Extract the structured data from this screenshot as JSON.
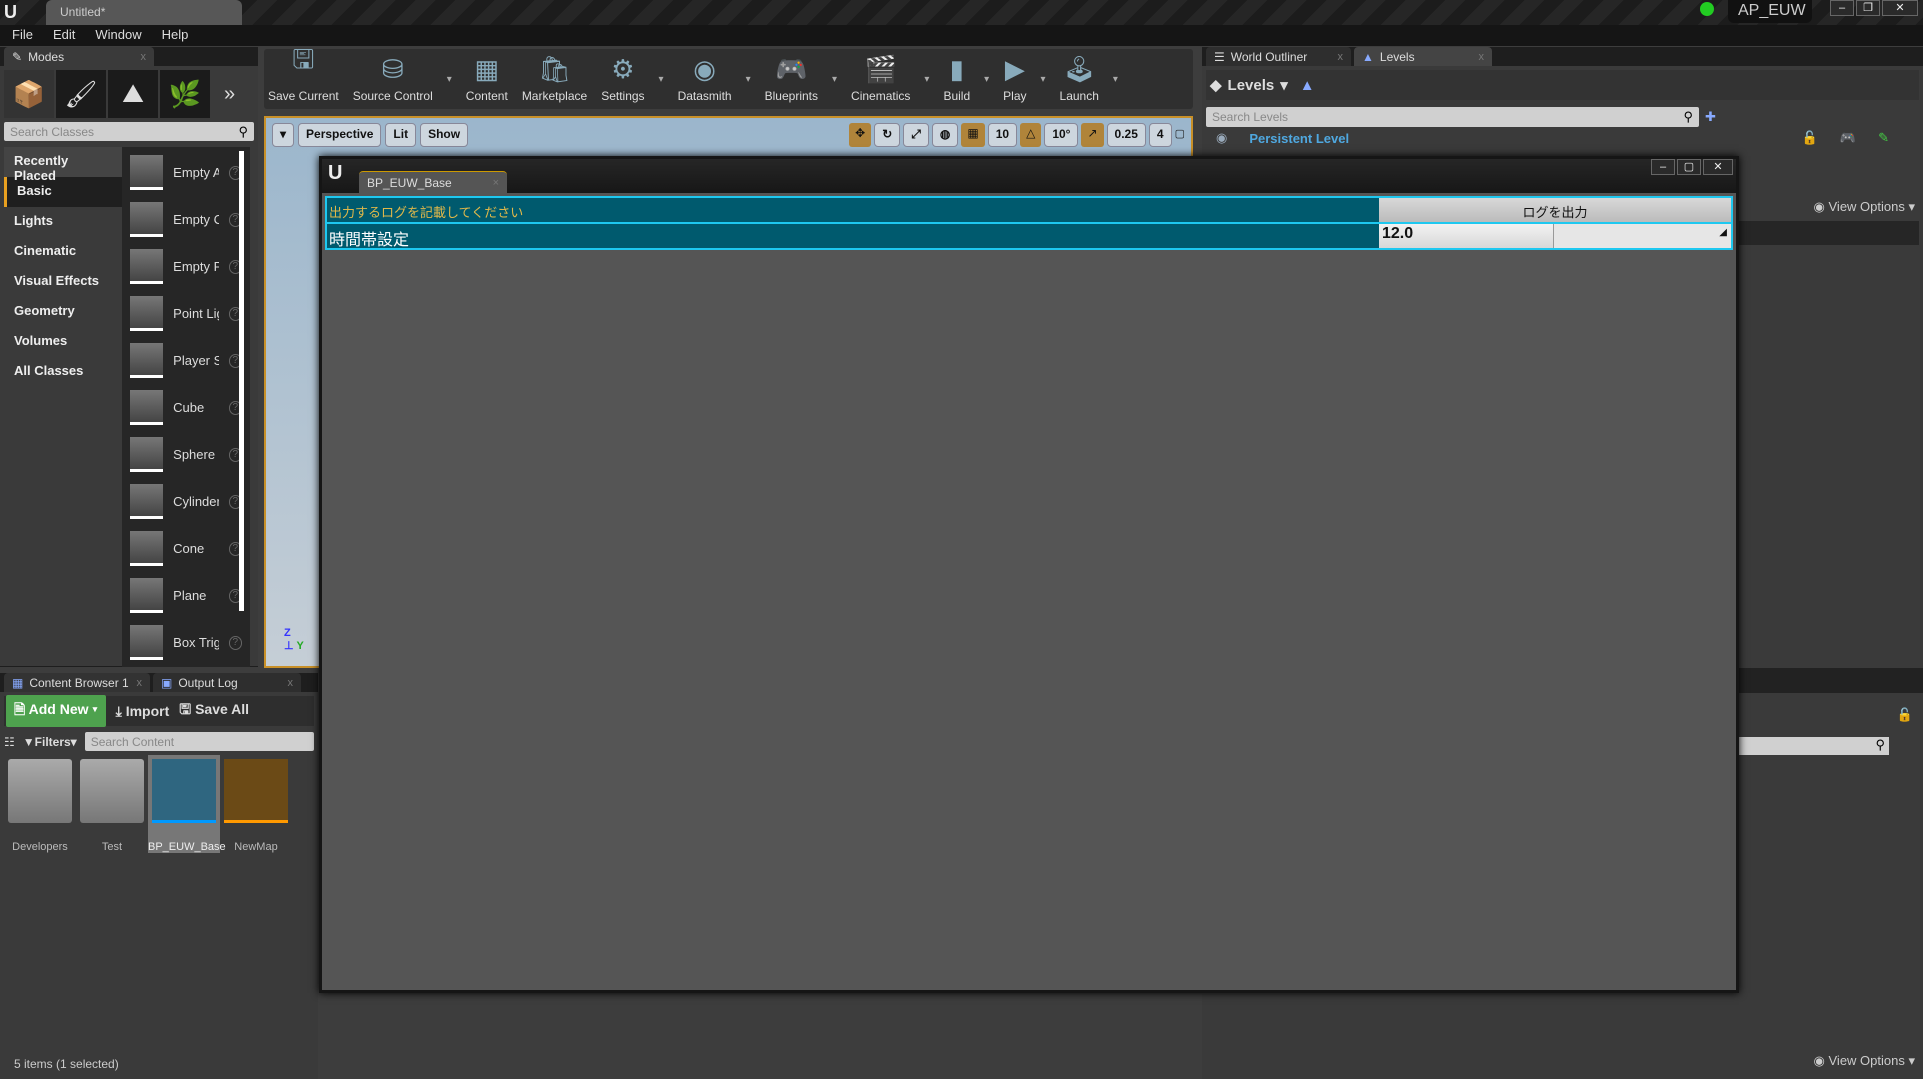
{
  "app": {
    "doc_tab": "Untitled*",
    "project": "AP_EUW"
  },
  "menu": [
    "File",
    "Edit",
    "Window",
    "Help"
  ],
  "modes": {
    "tab": "Modes",
    "search_placeholder": "Search Classes",
    "categories": [
      "Recently Placed",
      "Basic",
      "Lights",
      "Cinematic",
      "Visual Effects",
      "Geometry",
      "Volumes",
      "All Classes"
    ],
    "selected_category": "Basic",
    "items": [
      "Empty Actor",
      "Empty Character",
      "Empty Pawn",
      "Point Light",
      "Player Start",
      "Cube",
      "Sphere",
      "Cylinder",
      "Cone",
      "Plane",
      "Box Trigger"
    ]
  },
  "toolbar": [
    "Save Current",
    "Source Control",
    "Content",
    "Marketplace",
    "Settings",
    "Datasmith",
    "Blueprints",
    "Cinematics",
    "Build",
    "Play",
    "Launch"
  ],
  "viewport": {
    "perspective": "Perspective",
    "lit": "Lit",
    "show": "Show",
    "grid": "10",
    "angle": "10°",
    "scale": "0.25",
    "speed": "4"
  },
  "right": {
    "tabs": [
      "World Outliner",
      "Levels"
    ],
    "levels_label": "Levels",
    "search_placeholder": "Search Levels",
    "persistent_level": "Persistent Level",
    "view_options": "View Options"
  },
  "dialog": {
    "tab": "BP_EUW_Base",
    "log_placeholder": "出力するログを記載してください",
    "log_button": "ログを出力",
    "time_label": "時間帯設定",
    "time_value": "12.0"
  },
  "content": {
    "tabs": [
      "Content Browser 1",
      "Output Log"
    ],
    "add_new": "Add New",
    "import": "Import",
    "save_all": "Save All",
    "filters": "Filters",
    "search_placeholder": "Search Content",
    "assets": [
      "Developers",
      "Test",
      "BP_EUW_Base",
      "NewMap"
    ],
    "status": "5 items (1 selected)",
    "view_options": "View Options"
  },
  "colors": {
    "accent": "#e8a020",
    "dialog_row": "#005a6e",
    "row_border": "#1ec8f0",
    "add_new": "#4ea24e",
    "link": "#4fa8e0"
  }
}
